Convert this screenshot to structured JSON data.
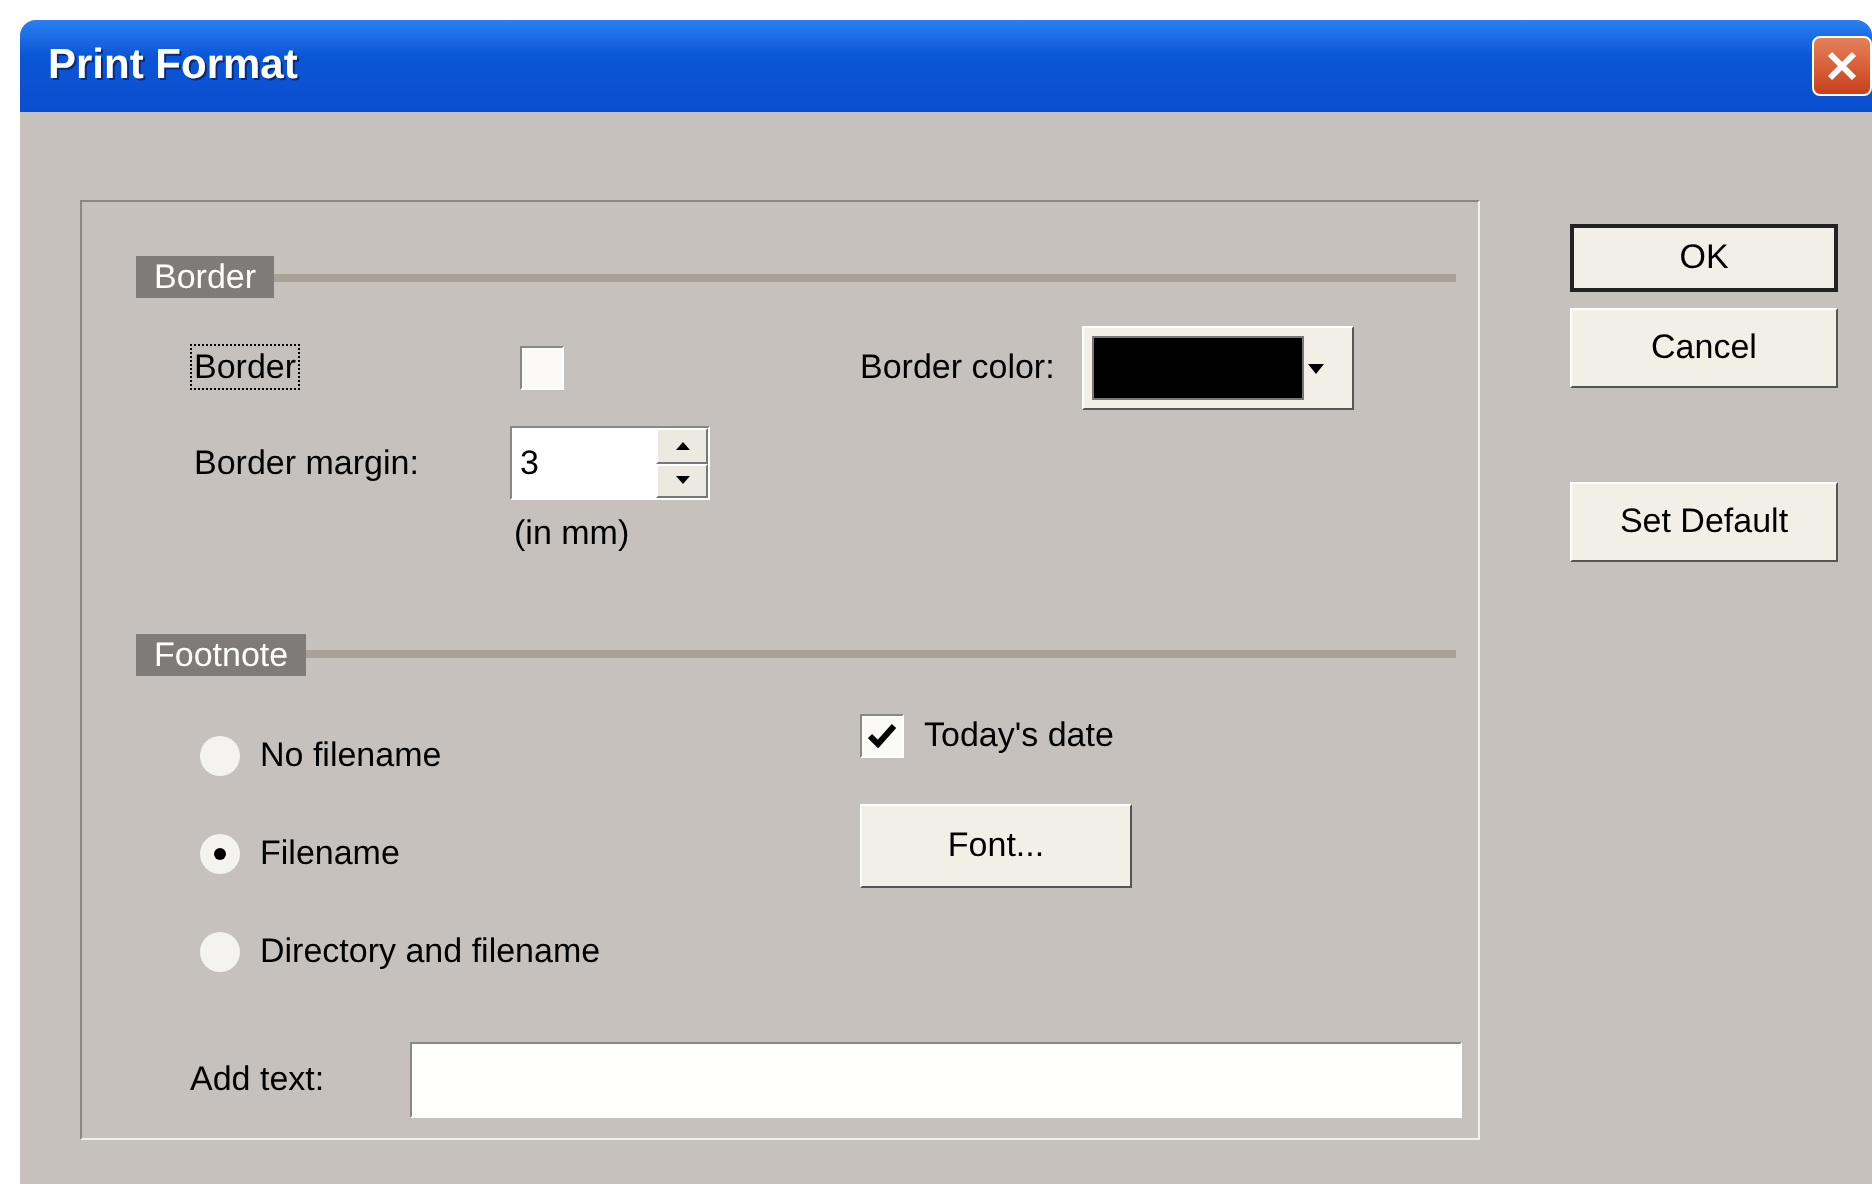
{
  "window": {
    "title": "Print Format"
  },
  "border_section": {
    "heading": "Border",
    "border_checkbox": {
      "label": "Border",
      "checked": false,
      "focused": true
    },
    "border_color": {
      "label": "Border color:",
      "color": "#000000"
    },
    "border_margin": {
      "label": "Border margin:",
      "value": "3",
      "unit_note": "(in mm)"
    }
  },
  "footnote_section": {
    "heading": "Footnote",
    "options": [
      {
        "label": "No filename",
        "selected": false
      },
      {
        "label": "Filename",
        "selected": true
      },
      {
        "label": "Directory and filename",
        "selected": false
      }
    ],
    "todays_date": {
      "label": "Today's date",
      "checked": true
    },
    "font_button": "Font...",
    "add_text": {
      "label": "Add text:"
    }
  },
  "button_groups": [
    {
      "buttons": [
        {
          "label": "OK",
          "default": true
        },
        {
          "label": "Cancel",
          "default": false
        }
      ]
    },
    {
      "buttons": [
        {
          "label": "Set Default",
          "default": false
        }
      ]
    }
  ]
}
